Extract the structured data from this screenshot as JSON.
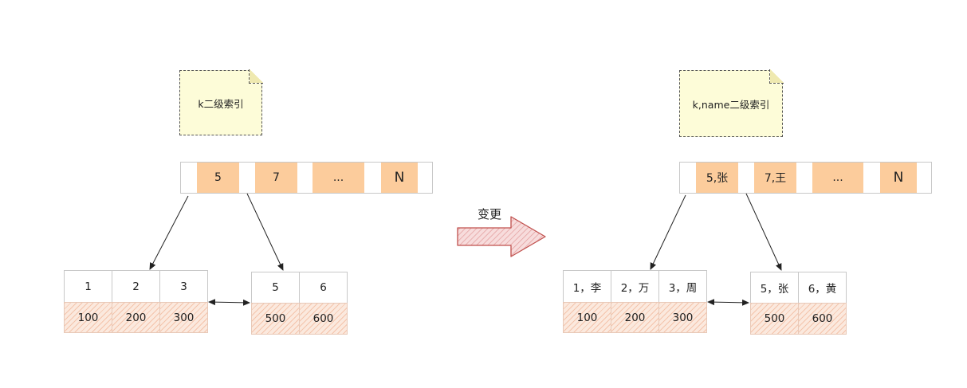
{
  "change_label": "变更",
  "left": {
    "note": "k二级索引",
    "root_keys": [
      "5",
      "7",
      "...",
      "N"
    ],
    "leaf1": {
      "keys": [
        "1",
        "2",
        "3"
      ],
      "values": [
        "100",
        "200",
        "300"
      ]
    },
    "leaf2": {
      "keys": [
        "5",
        "6"
      ],
      "values": [
        "500",
        "600"
      ]
    }
  },
  "right": {
    "note": "k,name二级索引",
    "root_keys": [
      "5,张",
      "7,王",
      "...",
      "N"
    ],
    "leaf1": {
      "keys": [
        "1，李",
        "2，万",
        "3，周"
      ],
      "values": [
        "100",
        "200",
        "300"
      ]
    },
    "leaf2": {
      "keys": [
        "5，张",
        "6，黄"
      ],
      "values": [
        "500",
        "600"
      ]
    }
  },
  "colors": {
    "key_fill": "#fccc9c",
    "note_fill": "#fdfcd8",
    "arrow_red": "#c0504d",
    "hatch": "#eea582"
  }
}
